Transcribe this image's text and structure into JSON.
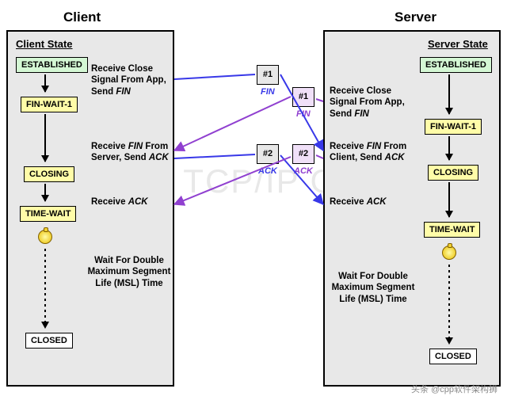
{
  "titles": {
    "client": "Client",
    "server": "Server"
  },
  "headers": {
    "client": "Client State",
    "server": "Server State"
  },
  "states": {
    "established": "ESTABLISHED",
    "finwait1": "FIN-WAIT-1",
    "closing": "CLOSING",
    "timewait": "TIME-WAIT",
    "closed": "CLOSED"
  },
  "events": {
    "recvCloseSendFin": "Receive Close Signal From App, Send <i>FIN</i>",
    "recvFinSrvSendAck": "Receive <i>FIN</i> From Server, Send <i>ACK</i>",
    "recvFinCliSendAck": "Receive <i>FIN</i> From Client, Send <i>ACK</i>",
    "recvAck": "Receive <i>ACK</i>",
    "waitMSL": "Wait For Double Maximum Segment Life (MSL) Time"
  },
  "msgs": {
    "one": "#1",
    "two": "#2",
    "fin": "FIN",
    "ack": "ACK"
  },
  "watermark": "The TCP/IP Guide",
  "attribution": "头条 @cpp软件架构狮"
}
